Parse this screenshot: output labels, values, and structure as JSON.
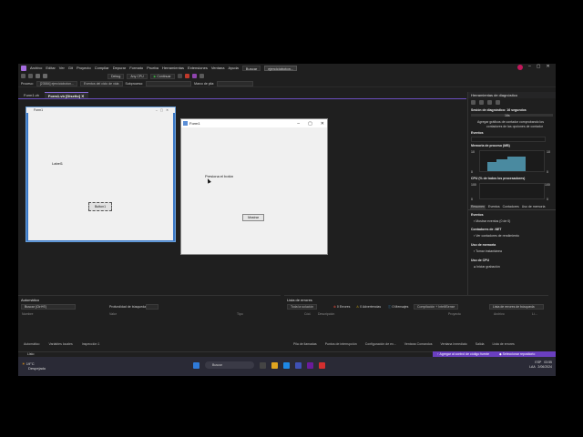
{
  "menubar": {
    "items": [
      "Archivo",
      "Editar",
      "Ver",
      "Git",
      "Proyecto",
      "Compilar",
      "Depurar",
      "Formato",
      "Prueba",
      "Herramientas",
      "Extensiones",
      "Ventana",
      "Ayuda"
    ],
    "search_label": "Buscar",
    "solution_name": "ejercicioboton..."
  },
  "toolbar": {
    "config": "Debug",
    "platform": "Any CPU",
    "continue_label": "Continuar"
  },
  "navbar": {
    "process": "Proceso:",
    "process_value": "[23584] ejercicioboton...",
    "events": "Eventos del ciclo de vida",
    "thread": "Subproceso:",
    "stack": "Marco de pila:"
  },
  "doc_tabs": [
    "Form1.vb",
    "Form1.vb [Diseño]"
  ],
  "design_form": {
    "title": "Form1",
    "label": "Label1",
    "button": "Button1"
  },
  "run_form": {
    "title": "Form1",
    "label": "Presiona el botón",
    "button": "Mostrar"
  },
  "diagnostics": {
    "title": "Herramientas de diagnóstico",
    "session": "Sesión de diagnóstico: 16 segundos",
    "session_end": "16s",
    "tip_line1": "Agregar gráficos de contador comprobando los",
    "tip_line2": "contadores de las opciones de contador",
    "events_label": "Eventos",
    "memory_label": "Memoria de proceso (MB)",
    "memory_scale_top": "10",
    "memory_scale_bottom": "0",
    "cpu_label": "CPU (% de todos los procesadores)",
    "cpu_scale_top": "100",
    "cpu_scale_bottom": "0",
    "tabs": [
      "Resumen",
      "Eventos",
      "Contadores",
      "Uso de memoria"
    ],
    "events_section": "Eventos",
    "show_events": "Mostrar eventos (0 de 0)",
    "counters_section": "Contadores de .NET",
    "no_counters": "Ver contadores de rendimiento",
    "memory_section": "Uso de memoria",
    "take_snapshot": "Tomar instantánea",
    "cpu_section": "Uso de CPU",
    "start_recording": "Iniciar grabación"
  },
  "autos": {
    "title": "Automático",
    "search": "Buscar (Ctrl+E)",
    "depth": "Profundidad de búsqueda:",
    "columns": [
      "Nombre",
      "Valor",
      "Tipo"
    ]
  },
  "errors": {
    "title": "Lista de errores",
    "scope": "Toda la solución",
    "errors": "0 Errores",
    "warnings": "0 Advertencias",
    "messages": "0 Mensajes",
    "build": "Compilación + IntelliSense",
    "search": "Lista de errores de búsqueda",
    "columns": [
      "Cód.",
      "Descripción",
      "Proyecto",
      "Archivo",
      "Lí..."
    ]
  },
  "bottom_tabs_left": [
    "Automático",
    "Variables locales",
    "Inspección 1"
  ],
  "bottom_tabs_right": [
    "Pila de llamadas",
    "Puntos de interrupción",
    "Configuración de ex...",
    "Ventana Comandos",
    "Ventana Inmediato",
    "Salida",
    "Lista de errores"
  ],
  "status": {
    "ready": "Listo",
    "source_control": "Agregar al control de código fuente",
    "repo": "Seleccionar repositorio"
  },
  "taskbar": {
    "temp": "19°C",
    "weather": "Despejado",
    "search": "Buscar",
    "lang": "ESP",
    "lang2": "LAA",
    "time": "03:55",
    "date": "2/06/2024"
  }
}
